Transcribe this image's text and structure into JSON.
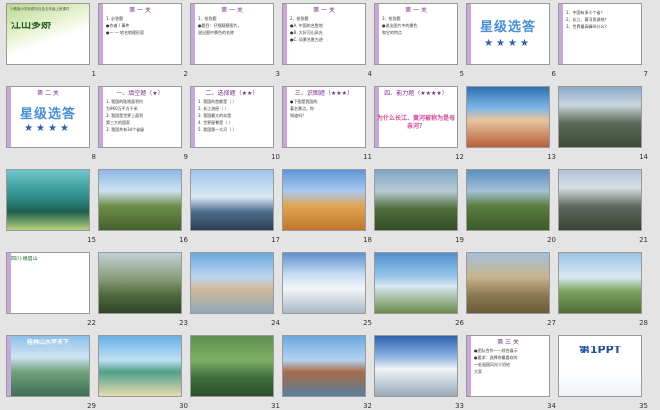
{
  "slides": [
    {
      "n": "1",
      "title": "江山多娇",
      "header": "人教版小学品德与社会五年级上册课件"
    },
    {
      "n": "2",
      "title": "第 一 关",
      "lines": [
        "1. 必答题",
        "●作者 / 事件",
        "●一 一 地名地理形容"
      ]
    },
    {
      "n": "3",
      "title": "第 一 关",
      "lines": [
        "1、抢答题",
        "●题目：仔细观察图片，",
        "  说出图中景色的名称"
      ]
    },
    {
      "n": "4",
      "title": "第 一 关",
      "lines": [
        "2、抢答题",
        "●A. 中国的名胜地",
        "●B. 大好河山风光",
        "●C. 风景名胜古迹"
      ]
    },
    {
      "n": "5",
      "title": "第 一 关",
      "lines": [
        "3、抢答题",
        "●说出图片中的景色",
        "  和它的特点"
      ]
    },
    {
      "n": "6",
      "big": "星级选答",
      "stars": "★★★★"
    },
    {
      "n": "7",
      "lines": [
        "1、中国有多少个省？",
        "2、长江、黄河发源地？",
        "3、世界最高峰叫什么？"
      ]
    },
    {
      "n": "8",
      "title": "第 二 关",
      "big": "星级选答",
      "stars": "★★★★"
    },
    {
      "n": "9",
      "title": "一、填空题（★）",
      "lines": [
        "1. 我国的陆地面积约",
        "  为960万平方千米",
        "2. 我国是世界上面积",
        "  第三大的国家",
        "3. 我国共有34个省级"
      ]
    },
    {
      "n": "10",
      "title": "二、选择题（★★）",
      "lines": [
        "1. 我国的首都是（ ）",
        "2. 长江流经（ ）",
        "3. 我国最大的岛是",
        "4. 世界屋脊是（ ）",
        "5. 我国第一大河（ ）"
      ]
    },
    {
      "n": "11",
      "title": "三、识图题（★★★）",
      "lines": [
        "●下图是我国的",
        "  著名景点，你",
        "  知道吗？"
      ]
    },
    {
      "n": "12",
      "title": "四、能力题（★★★★）",
      "big2": "为什么长江、黄河被称为是母亲河？"
    },
    {
      "n": "13"
    },
    {
      "n": "14"
    },
    {
      "n": "15"
    },
    {
      "n": "16"
    },
    {
      "n": "17"
    },
    {
      "n": "18"
    },
    {
      "n": "19"
    },
    {
      "n": "20"
    },
    {
      "n": "21"
    },
    {
      "n": "22",
      "lines": [
        "四川·峨眉山"
      ]
    },
    {
      "n": "23"
    },
    {
      "n": "24"
    },
    {
      "n": "25"
    },
    {
      "n": "26"
    },
    {
      "n": "27"
    },
    {
      "n": "28"
    },
    {
      "n": "29",
      "title": "桂林山水甲天下"
    },
    {
      "n": "30"
    },
    {
      "n": "31"
    },
    {
      "n": "32"
    },
    {
      "n": "33"
    },
    {
      "n": "34",
      "title": "第 三 关",
      "lines": [
        "●团队合作——综合展示",
        "●要求：选择你最喜欢的",
        "  一处祖国风光介绍给",
        "  大家"
      ]
    },
    {
      "n": "35",
      "title": "第1PPT"
    }
  ]
}
